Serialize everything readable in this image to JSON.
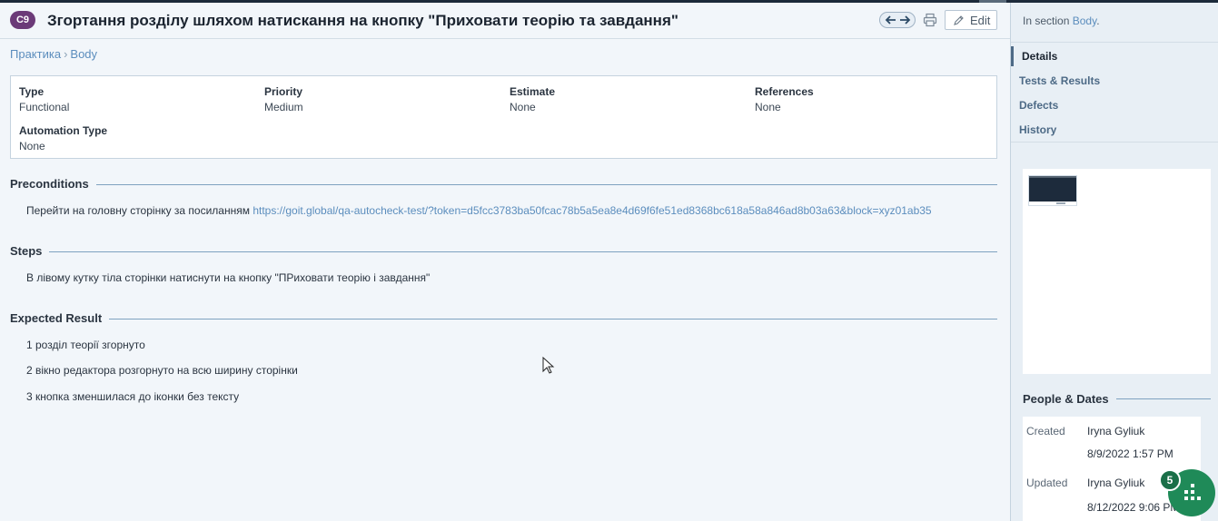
{
  "header": {
    "case_id": "C9",
    "title": "Згортання розділу шляхом натискання на кнопку \"Приховати теорію та завдання\"",
    "edit_label": "Edit"
  },
  "breadcrumb": {
    "items": [
      "Практика",
      "Body"
    ],
    "separator": "›"
  },
  "properties": {
    "type": {
      "label": "Type",
      "value": "Functional"
    },
    "priority": {
      "label": "Priority",
      "value": "Medium"
    },
    "estimate": {
      "label": "Estimate",
      "value": "None"
    },
    "references": {
      "label": "References",
      "value": "None"
    },
    "automation_type": {
      "label": "Automation Type",
      "value": "None"
    }
  },
  "preconditions": {
    "title": "Preconditions",
    "text": "Перейти на головну сторінку за посиланням",
    "link": "https://goit.global/qa-autocheck-test/?token=d5fcc3783ba50fcac78b5a5ea8e4d69f6fe51ed8368bc618a58a846ad8b03a63&block=xyz01ab35"
  },
  "steps": {
    "title": "Steps",
    "text": "В лівому кутку тіла сторінки натиснути на кнопку \"ПРиховати теорію і завдання\""
  },
  "expected": {
    "title": "Expected Result",
    "lines": [
      "1 розділ теорії згорнуто",
      "2 вікно редактора розгорнуто на всю ширину сторінки",
      "3 кнопка зменшилася до іконки без тексту"
    ]
  },
  "sidebar": {
    "section_prefix": "In section",
    "section_name": "Body",
    "section_suffix": ".",
    "tabs": [
      "Details",
      "Tests & Results",
      "Defects",
      "History"
    ],
    "active_tab": "Details",
    "people_title": "People & Dates",
    "created_label": "Created",
    "created_by": "Iryna Gyliuk",
    "created_at": "8/9/2022 1:57 PM",
    "updated_label": "Updated",
    "updated_by": "Iryna Gyliuk",
    "updated_at": "8/12/2022 9:06 PM"
  },
  "widget": {
    "badge_count": "5"
  },
  "colors": {
    "badge": "#6b3a78",
    "link": "#5b8dbd",
    "fab": "#1f8a58",
    "header_bar": "#1c2a3a"
  },
  "icons": [
    "arrow-left-icon",
    "arrow-right-icon",
    "print-icon",
    "pencil-icon",
    "cursor-icon",
    "grid-dots-icon"
  ]
}
